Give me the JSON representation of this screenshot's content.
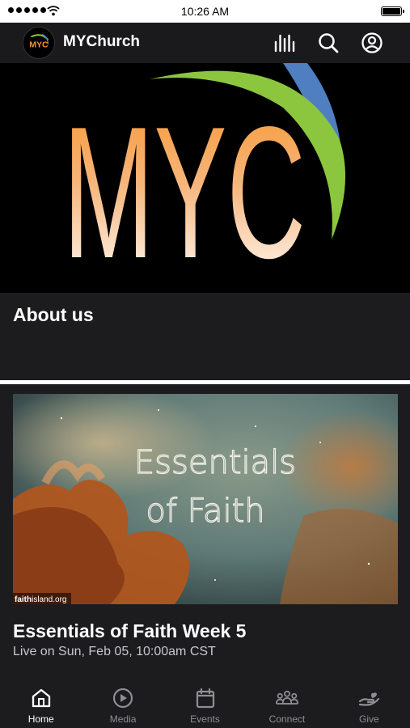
{
  "status_bar": {
    "time": "10:26 AM"
  },
  "header": {
    "title": "MYChurch",
    "logo_text": "MYC"
  },
  "hero": {
    "logo_text": "MYC"
  },
  "about": {
    "title": "About us"
  },
  "featured": {
    "image_title_line1": "Essentials",
    "image_title_line2": "of Faith",
    "watermark_bold": "faith",
    "watermark_rest": "island.org",
    "title": "Essentials of Faith Week 5",
    "subtitle": "Live on Sun, Feb 05, 10:00am CST"
  },
  "tabs": [
    {
      "label": "Home",
      "icon": "home-icon",
      "active": true
    },
    {
      "label": "Media",
      "icon": "play-circle-icon",
      "active": false
    },
    {
      "label": "Events",
      "icon": "calendar-icon",
      "active": false
    },
    {
      "label": "Connect",
      "icon": "people-icon",
      "active": false
    },
    {
      "label": "Give",
      "icon": "hand-heart-icon",
      "active": false
    }
  ],
  "colors": {
    "background": "#1c1c1e",
    "header": "#1a1a1c",
    "logo_orange": "#f7962e",
    "logo_green": "#8cc63f",
    "logo_blue": "#4f7fc1",
    "inactive_tab": "#8e8e93"
  }
}
